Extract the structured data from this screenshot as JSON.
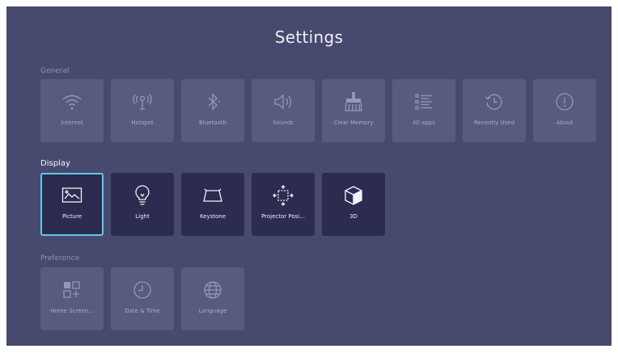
{
  "header": {
    "title": "Settings"
  },
  "sections": {
    "general": {
      "label": "General",
      "items": [
        {
          "label": "Internet",
          "icon": "wifi-icon"
        },
        {
          "label": "Hotspot",
          "icon": "hotspot-icon"
        },
        {
          "label": "Bluetooth",
          "icon": "bluetooth-icon"
        },
        {
          "label": "Sounds",
          "icon": "speaker-icon"
        },
        {
          "label": "Clear Memory",
          "icon": "broom-icon"
        },
        {
          "label": "All apps",
          "icon": "list-icon"
        },
        {
          "label": "Recently Used",
          "icon": "history-icon"
        },
        {
          "label": "About",
          "icon": "info-icon"
        }
      ]
    },
    "display": {
      "label": "Display",
      "items": [
        {
          "label": "Picture",
          "icon": "picture-icon",
          "selected": true
        },
        {
          "label": "Light",
          "icon": "lightbulb-icon"
        },
        {
          "label": "Keystone",
          "icon": "keystone-icon"
        },
        {
          "label": "Projector Posi...",
          "icon": "projector-position-icon"
        },
        {
          "label": "3D",
          "icon": "cube-icon"
        }
      ]
    },
    "preference": {
      "label": "Preference",
      "items": [
        {
          "label": "Home Screen...",
          "icon": "home-screen-icon"
        },
        {
          "label": "Date & Time",
          "icon": "clock-icon"
        },
        {
          "label": "Language",
          "icon": "globe-icon"
        }
      ]
    }
  },
  "colors": {
    "background": "#48496e",
    "tile": "#56587c",
    "tile_active": "#2b2c4f",
    "focus_border": "#5fc7e6",
    "title_text": "#eef0f8"
  }
}
